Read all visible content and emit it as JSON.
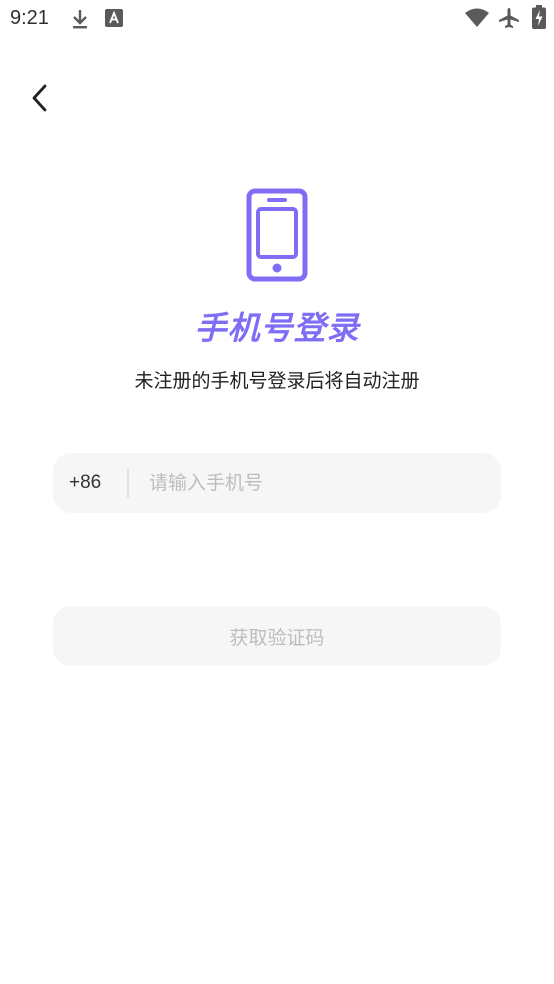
{
  "status_bar": {
    "time": "9:21",
    "icons": [
      "download-icon",
      "font-a-icon",
      "wifi-icon",
      "airplane-mode-icon",
      "battery-charging-icon"
    ]
  },
  "header": {
    "back_icon": "chevron-left-icon"
  },
  "hero": {
    "icon": "smartphone-icon",
    "title": "手机号登录",
    "subtitle": "未注册的手机号登录后将自动注册"
  },
  "form": {
    "country_code": "+86",
    "phone_placeholder": "请输入手机号",
    "phone_value": "",
    "get_code_label": "获取验证码"
  },
  "colors": {
    "accent": "#7f6ef5",
    "input_bg": "#f6f6f6",
    "placeholder": "#bdbdbd",
    "text": "#222222"
  }
}
